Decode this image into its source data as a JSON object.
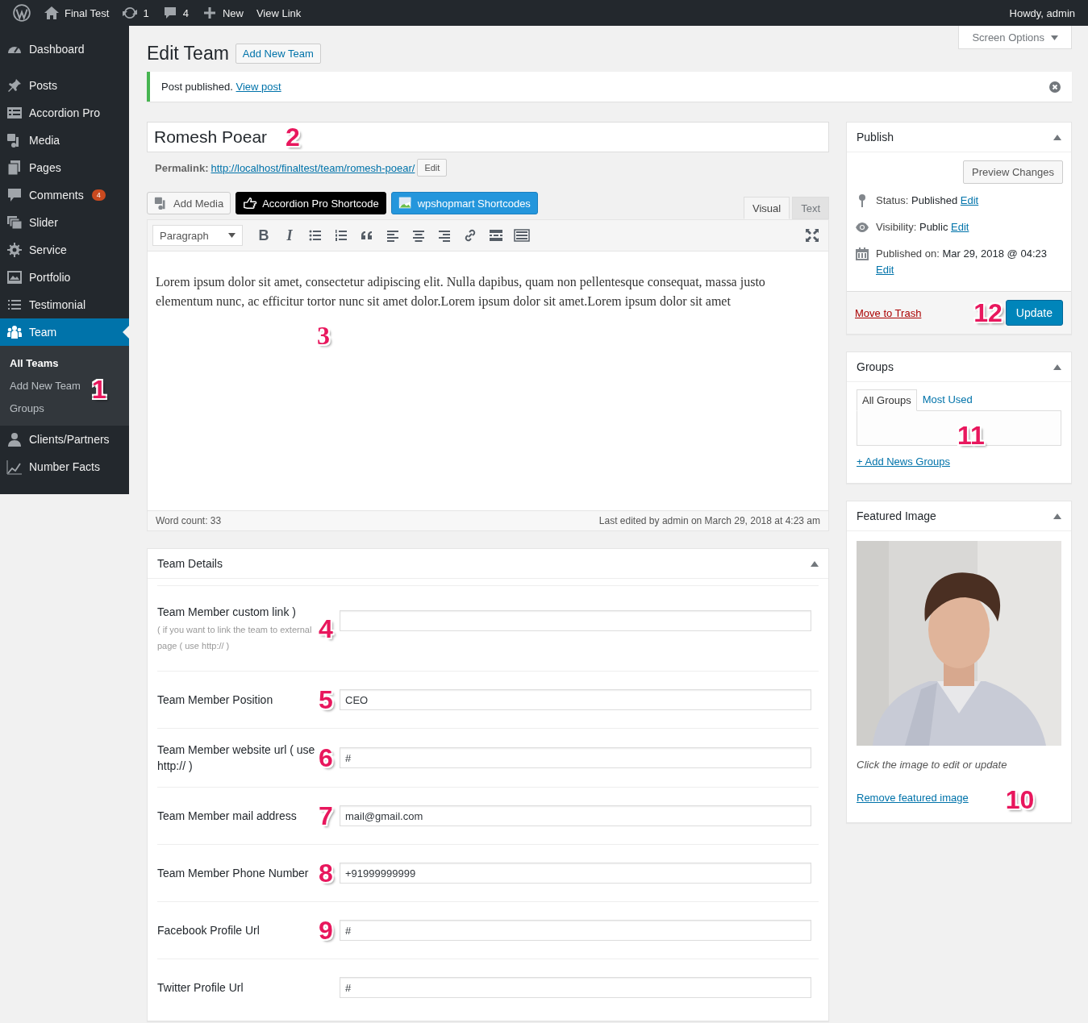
{
  "admin_bar": {
    "items": [
      {
        "kind": "logo"
      },
      {
        "kind": "home",
        "label": "Final Test"
      },
      {
        "kind": "updates",
        "label": "1"
      },
      {
        "kind": "comments",
        "label": "4"
      },
      {
        "kind": "new",
        "label": "New"
      },
      {
        "kind": "link",
        "label": "View Link"
      }
    ],
    "greeting": "Howdy, admin"
  },
  "sidebar": {
    "groups": [
      {
        "items": [
          {
            "label": "Dashboard",
            "selected": false
          }
        ]
      },
      {
        "items": [
          {
            "label": "Posts",
            "selected": false
          },
          {
            "label": "Accordion Pro",
            "selected": false
          },
          {
            "label": "Media",
            "selected": false
          },
          {
            "label": "Pages",
            "selected": false
          },
          {
            "label": "Comments",
            "selected": false,
            "badge": "4"
          },
          {
            "label": "Slider",
            "selected": false
          },
          {
            "label": "Service",
            "selected": false
          },
          {
            "label": "Portfolio",
            "selected": false
          },
          {
            "label": "Testimonial",
            "selected": false
          },
          {
            "label": "Team",
            "selected": true,
            "annotation": "1",
            "children": [
              {
                "label": "All Teams",
                "selected": true
              },
              {
                "label": "Add New Team",
                "selected": false
              },
              {
                "label": "Groups",
                "selected": false
              }
            ]
          },
          {
            "label": "Clients/Partners",
            "selected": false
          },
          {
            "label": "Number Facts",
            "selected": false
          }
        ]
      }
    ]
  },
  "screen_options": "Screen Options",
  "page": {
    "title": "Edit Team",
    "add_new": "Add New Team"
  },
  "notice": {
    "text": "Post published.",
    "link": "View post"
  },
  "post_title": {
    "value": "Romesh Poear",
    "annotation": "2"
  },
  "permalink": {
    "label": "Permalink:",
    "url": "http://localhost/finaltest/team/romesh-poear/",
    "button": "Edit"
  },
  "media_buttons": [
    {
      "kind": "media",
      "label": "Add Media"
    },
    {
      "kind": "dark",
      "label": "Accordion Pro Shortcode"
    },
    {
      "kind": "blue",
      "label": "wpshopmart Shortcodes"
    }
  ],
  "editor_tabs": [
    {
      "label": "Visual",
      "selected": true
    },
    {
      "label": "Text",
      "selected": false
    }
  ],
  "toolbar": {
    "format": "Paragraph",
    "buttons": [
      {
        "kind": "bold",
        "label": "B"
      },
      {
        "kind": "italic",
        "label": "I"
      },
      {
        "kind": "bullets"
      },
      {
        "kind": "numbers"
      },
      {
        "kind": "quote"
      },
      {
        "kind": "align-left"
      },
      {
        "kind": "align-center"
      },
      {
        "kind": "align-right"
      },
      {
        "kind": "link"
      },
      {
        "kind": "more"
      },
      {
        "kind": "toolbar-toggle"
      }
    ]
  },
  "content": {
    "text": "Lorem ipsum dolor sit amet, consectetur adipiscing elit. Nulla dapibus, quam non pellentesque consequat, massa justo elementum nunc, ac efficitur tortor nunc sit amet dolor.Lorem ipsum dolor sit amet.Lorem ipsum dolor sit amet",
    "annotation": "3"
  },
  "editor_status": {
    "word_count": "Word count: 33",
    "last_edited": "Last edited by admin on March 29, 2018 at 4:23 am"
  },
  "team_details": {
    "title": "Team Details",
    "fields": [
      {
        "label": "Team Member custom link )",
        "hint": "( if you want to link the team to external page ( use http:// )",
        "annotation": "4"
      },
      {
        "label": "Team Member Position",
        "value": "CEO",
        "annotation": "5"
      },
      {
        "label": "Team Member website url ( use http:// )",
        "value": "#",
        "annotation": "6"
      },
      {
        "label": "Team Member mail address",
        "value": "mail@gmail.com",
        "annotation": "7"
      },
      {
        "label": "Team Member Phone Number",
        "value": "+91999999999",
        "annotation": "8"
      },
      {
        "label": "Facebook Profile Url",
        "value": "#",
        "annotation": "9"
      },
      {
        "label": "Twitter Profile Url",
        "value": "#"
      }
    ]
  },
  "publish": {
    "title": "Publish",
    "preview": "Preview Changes",
    "rows": [
      {
        "kind": "status",
        "label": "Status:",
        "value": "Published",
        "link": "Edit"
      },
      {
        "kind": "visibility",
        "label": "Visibility:",
        "value": "Public",
        "link": "Edit"
      },
      {
        "kind": "date",
        "label": "Published on:",
        "value": "Mar 29, 2018 @ 04:23",
        "link": "Edit"
      }
    ],
    "trash": "Move to Trash",
    "update": "Update",
    "annotation": "12"
  },
  "groups": {
    "title": "Groups",
    "tabs": [
      {
        "label": "All Groups",
        "selected": true
      },
      {
        "label": "Most Used",
        "selected": false
      }
    ],
    "annotation": "11",
    "add_link": "+ Add News Groups"
  },
  "featured_image": {
    "title": "Featured Image",
    "kind": "picture",
    "caption": "Click the image to edit or update",
    "remove": "Remove featured image",
    "annotation": "10"
  }
}
